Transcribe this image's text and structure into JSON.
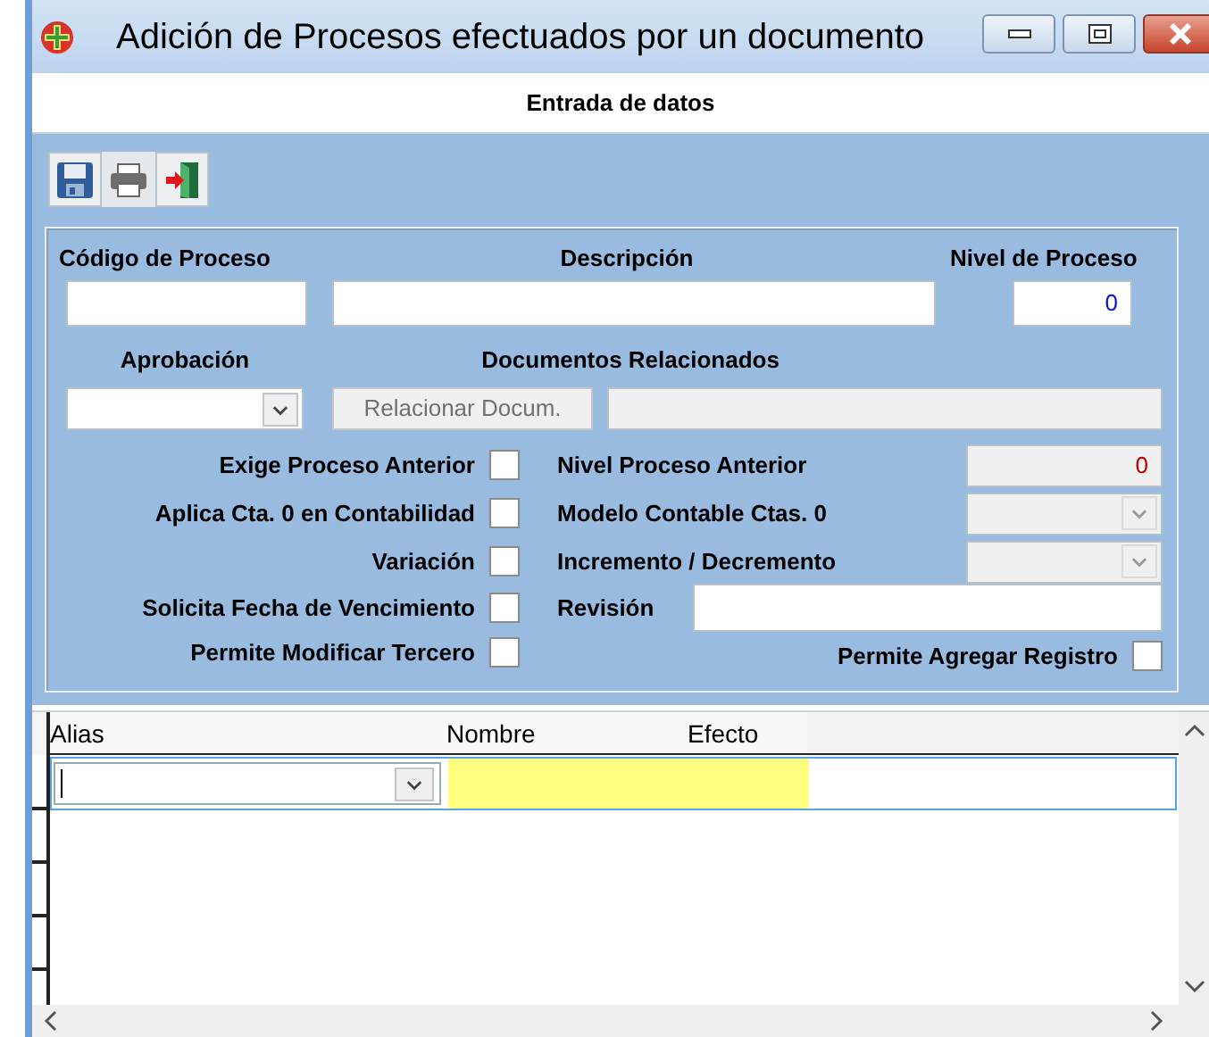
{
  "window": {
    "title": "Adición de Procesos efectuados por un documento"
  },
  "header": {
    "title": "Entrada de datos"
  },
  "form": {
    "codigo": {
      "label": "Código de Proceso"
    },
    "descripcion": {
      "label": "Descripción"
    },
    "nivel": {
      "label": "Nivel de Proceso",
      "value": "0"
    },
    "aprobacion": {
      "label": "Aprobación"
    },
    "documentos": {
      "label": "Documentos Relacionados",
      "button": "Relacionar Docum.",
      "disabled": true
    },
    "checks": [
      {
        "label": "Exige Proceso Anterior",
        "checked": false
      },
      {
        "label": "Aplica Cta. 0 en Contabilidad",
        "checked": false
      },
      {
        "label": "Variación",
        "checked": false
      },
      {
        "label": "Solicita Fecha de Vencimiento",
        "checked": false
      },
      {
        "label": "Permite Modificar Tercero",
        "checked": false
      }
    ],
    "right": [
      {
        "kind": "number",
        "label": "Nivel Proceso Anterior",
        "value": "0",
        "disabled": true
      },
      {
        "kind": "select",
        "label": "Modelo Contable Ctas. 0",
        "disabled": true
      },
      {
        "kind": "select",
        "label": "Incremento / Decremento",
        "disabled": true
      },
      {
        "kind": "text",
        "label": "Revisión",
        "disabled": false
      }
    ],
    "agregar": {
      "label": "Permite Agregar Registro",
      "checked": false
    }
  },
  "grid": {
    "columns": [
      {
        "label": "Alias"
      },
      {
        "label": "Nombre"
      },
      {
        "label": "Efecto"
      }
    ]
  }
}
